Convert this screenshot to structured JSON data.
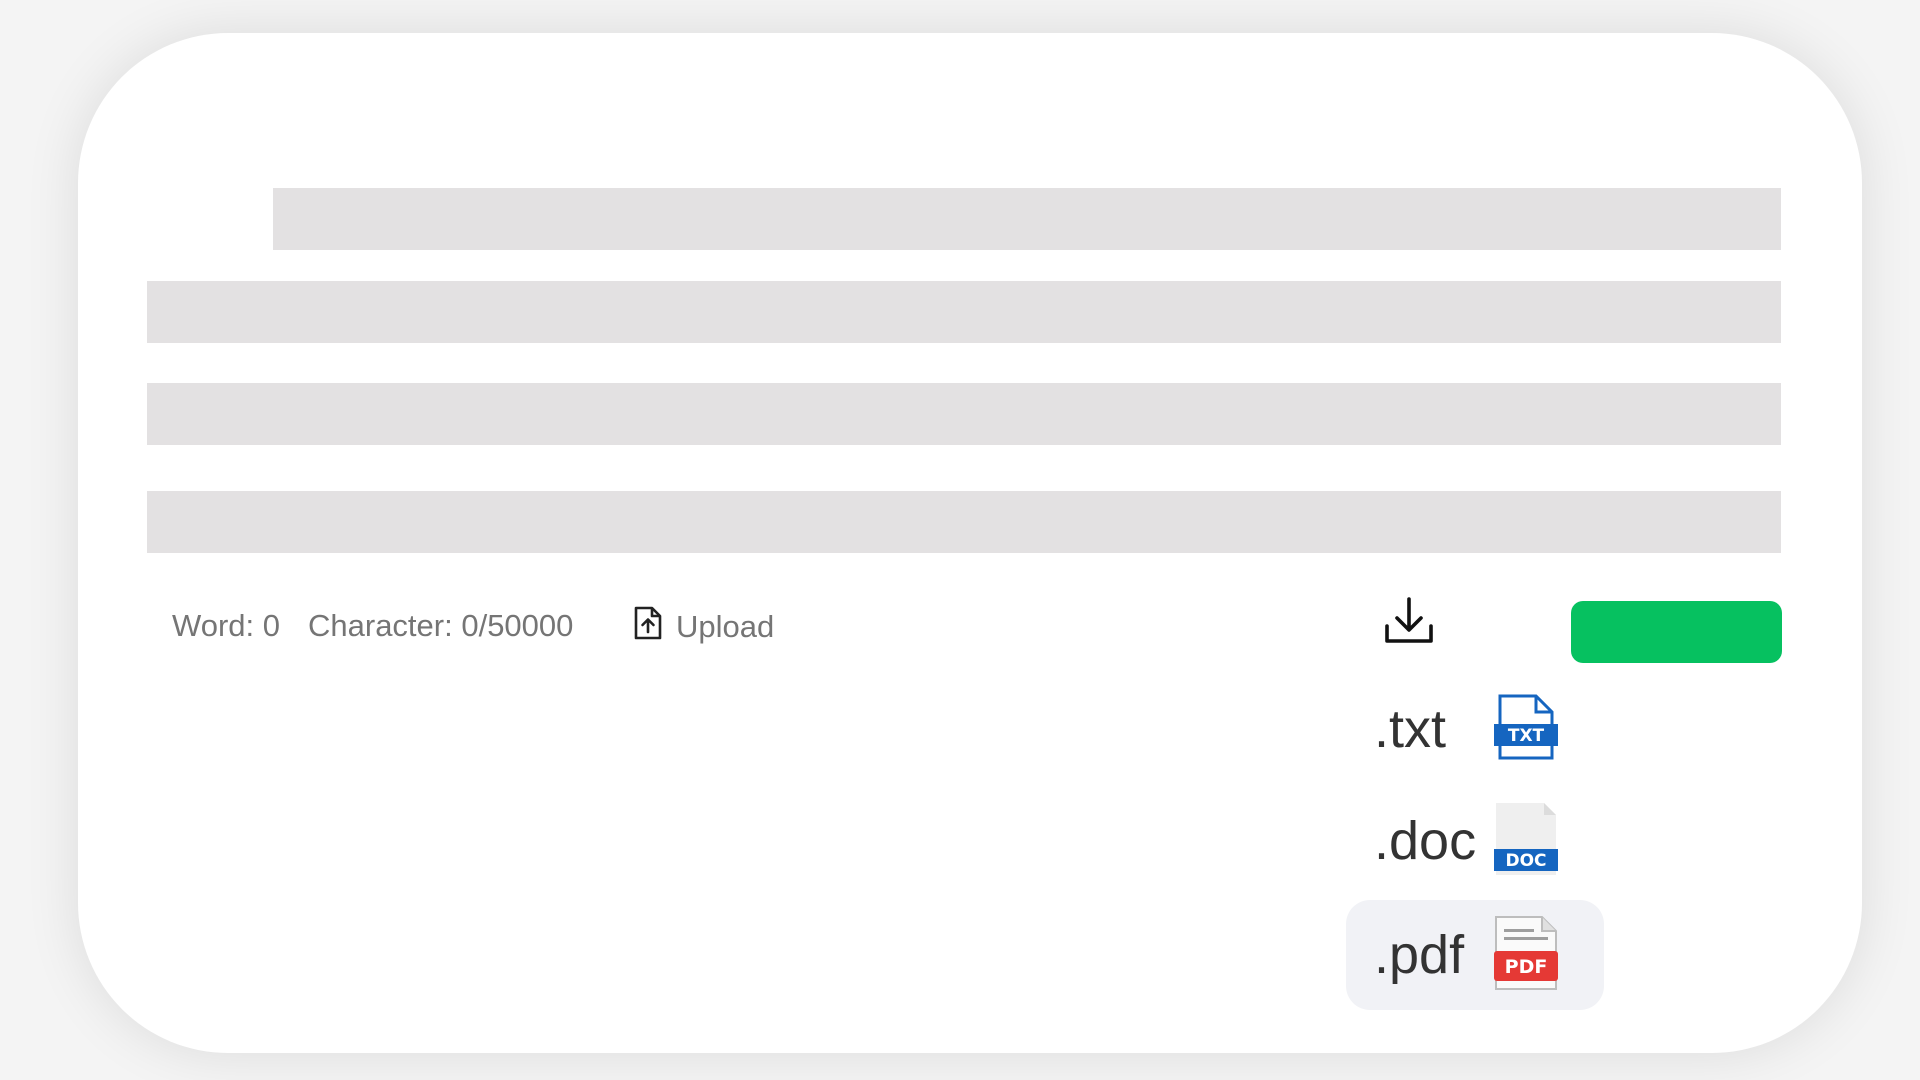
{
  "stats": {
    "word_label": "Word: 0",
    "char_label": "Character: 0/50000"
  },
  "upload": {
    "label": "Upload",
    "icon": "upload-file-icon"
  },
  "download": {
    "icon": "download-icon"
  },
  "primary_button": {
    "label": "",
    "color": "#06c160"
  },
  "download_menu": {
    "items": [
      {
        "ext": ".txt",
        "icon": "txt-file-icon",
        "badge": "TXT",
        "badge_color": "#1565c0"
      },
      {
        "ext": ".doc",
        "icon": "doc-file-icon",
        "badge": "DOC",
        "badge_color": "#1565c0"
      },
      {
        "ext": ".pdf",
        "icon": "pdf-file-icon",
        "badge": "PDF",
        "badge_color": "#e53935"
      }
    ],
    "hovered_item": ".pdf"
  },
  "colors": {
    "skeleton": "#e3e1e2",
    "card": "#ffffff"
  }
}
